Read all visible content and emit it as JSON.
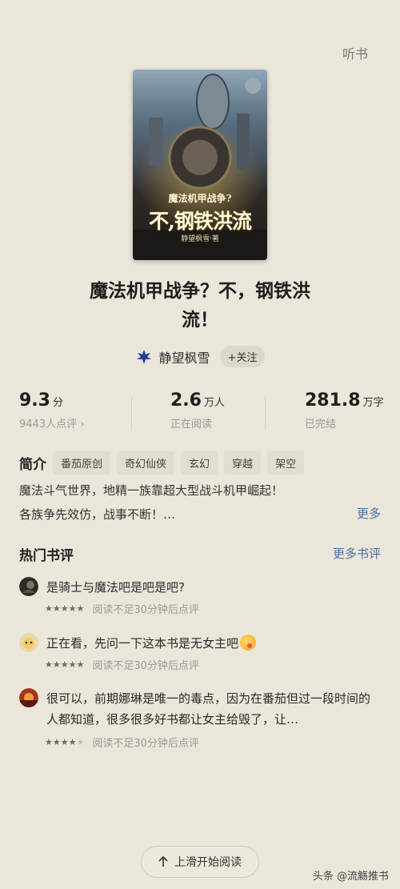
{
  "header": {
    "listen_label": "听书"
  },
  "cover": {
    "top_text": "魔法机甲战争?",
    "title_text": "不,钢铁洪流",
    "author_text": "静望枫雪·著"
  },
  "book": {
    "title_line1": "魔法机甲战争？不，钢铁洪",
    "title_line2": "流！",
    "author": "静望枫雪",
    "follow_label": "+关注"
  },
  "stats": [
    {
      "value": "9.3",
      "unit": "分",
      "sub": "9443人点评 ›"
    },
    {
      "value": "2.6",
      "unit": "万人",
      "sub": "正在阅读"
    },
    {
      "value": "281.8",
      "unit": "万字",
      "sub": "已完结"
    }
  ],
  "intro": {
    "label": "简介",
    "tags": [
      "番茄原创",
      "奇幻仙侠",
      "玄幻",
      "穿越",
      "架空"
    ],
    "line1": "魔法斗气世界，地精一族靠超大型战斗机甲崛起！",
    "line2": "各族争先效仿，战事不断！…",
    "more_label": "更多"
  },
  "reviews_section": {
    "title": "热门书评",
    "more_label": "更多书评"
  },
  "reviews": [
    {
      "text": "是骑士与魔法吧是吧是吧?",
      "stars": 5,
      "meta": "阅读不足30分钟后点评"
    },
    {
      "text": "正在看，先问一下这本书是无女主吧",
      "stars": 5,
      "meta": "阅读不足30分钟后点评"
    },
    {
      "text": "很可以，前期娜琳是唯一的毒点，因为在番茄但过一段时间的人都知道，很多很多好书都让女主给毁了，让…",
      "stars": 4,
      "meta": "阅读不足30分钟后点评"
    }
  ],
  "bottom": {
    "swipe_label": "上滑开始阅读",
    "watermark": "头条 @流觞推书"
  },
  "colors": {
    "background": "#ebe6da",
    "link": "#4a6fa5"
  }
}
